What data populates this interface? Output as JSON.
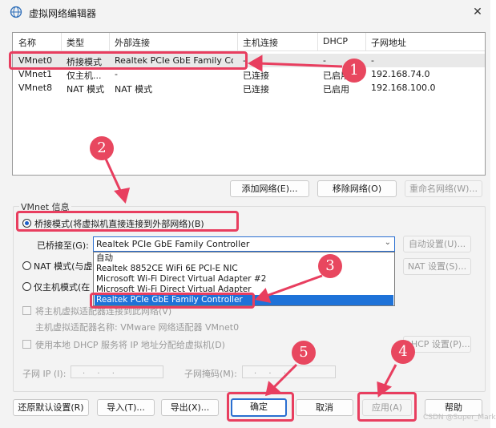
{
  "window": {
    "title": "虚拟网络编辑器",
    "close": "✕"
  },
  "list": {
    "headers": [
      "名称",
      "类型",
      "外部连接",
      "主机连接",
      "DHCP",
      "子网地址"
    ],
    "rows": [
      [
        "VMnet0",
        "桥接模式",
        "Realtek PCIe GbE Family Co...",
        "-",
        "-",
        "-"
      ],
      [
        "VMnet1",
        "仅主机...",
        "-",
        "已连接",
        "已启用",
        "192.168.74.0"
      ],
      [
        "VMnet8",
        "NAT 模式",
        "NAT 模式",
        "已连接",
        "已启用",
        "192.168.100.0"
      ]
    ]
  },
  "list_buttons": {
    "add": "添加网络(E)...",
    "remove": "移除网络(O)",
    "rename": "重命名网络(W)..."
  },
  "vmnet_info": {
    "title": "VMnet 信息",
    "bridged": "桥接模式(将虚拟机直接连接到外部网络)(B)",
    "bridged_to_label": "已桥接至(G):",
    "bridged_to_value": "Realtek PCIe GbE Family Controller",
    "auto_settings": "自动设置(U)...",
    "nat": "NAT 模式(与虚",
    "nat_settings": "NAT 设置(S)...",
    "host_only": "仅主机模式(在",
    "connect_host_adapter": "将主机虚拟适配器连接到此网络(V)",
    "host_adapter_name": "主机虚拟适配器名称: VMware 网络适配器 VMnet0",
    "use_dhcp": "使用本地 DHCP 服务将 IP 地址分配给虚拟机(D)",
    "dhcp_settings": "DHCP 设置(P)...",
    "subnet_ip_label": "子网 IP (I):",
    "subnet_mask_label": "子网掩码(M):",
    "ip_placeholder": ". . .",
    "mask_placeholder": ". . ."
  },
  "dropdown_options": [
    "自动",
    "Realtek 8852CE WiFi 6E PCI-E NIC",
    "Microsoft Wi-Fi Direct Virtual Adapter #2",
    "Microsoft Wi-Fi Direct Virtual Adapter",
    "Realtek PCIe GbE Family Controller"
  ],
  "bottom_buttons": {
    "restore": "还原默认设置(R)",
    "import": "导入(T)...",
    "export": "导出(X)...",
    "ok": "确定",
    "cancel": "取消",
    "apply": "应用(A)",
    "help": "帮助"
  },
  "annotations": [
    "1",
    "2",
    "3",
    "4",
    "5"
  ],
  "watermark": "CSDN @Super_Mark",
  "colors": {
    "annotation": "#e83e5f",
    "selection": "#1e72d8",
    "focus": "#2a6fd1"
  },
  "icons": {
    "title": "network-globe-icon",
    "combo": "chevron-down-icon",
    "close": "close-icon"
  }
}
